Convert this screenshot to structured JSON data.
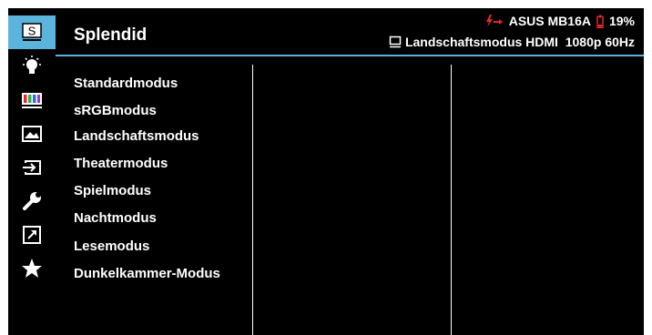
{
  "header": {
    "title": "Splendid",
    "device": "ASUS MB16A",
    "battery": "19%",
    "status": "Landschaftsmodus HDMI  1080p 60Hz"
  },
  "sidebar": {
    "items": [
      {
        "icon": "splendid-s-icon",
        "label": "S",
        "active": true
      },
      {
        "icon": "blue-light-filter-icon"
      },
      {
        "icon": "color-bars-icon"
      },
      {
        "icon": "image-icon"
      },
      {
        "icon": "input-select-icon"
      },
      {
        "icon": "wrench-icon"
      },
      {
        "icon": "shortcut-icon"
      },
      {
        "icon": "star-icon"
      }
    ]
  },
  "menu": {
    "items": [
      "Standardmodus",
      "sRGBmodus",
      "Landschaftsmodus",
      "Theatermodus",
      "Spielmodus",
      "Nachtmodus",
      "Lesemodus",
      "Dunkelkammer-Modus"
    ]
  },
  "colors": {
    "accent": "#5ab4dc",
    "background": "#000000",
    "text": "#ffffff",
    "warning": "#e8262d"
  }
}
